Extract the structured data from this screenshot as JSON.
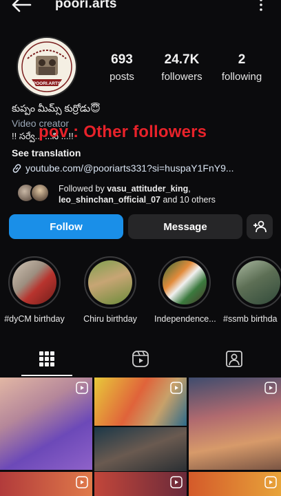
{
  "header": {
    "username": "poori.arts",
    "back_icon": "arrow-left-icon",
    "more_icon": "more-vertical-icon"
  },
  "stats": {
    "posts": {
      "value": "693",
      "label": "posts"
    },
    "followers": {
      "value": "24.7K",
      "label": "followers"
    },
    "following": {
      "value": "2",
      "label": "following"
    }
  },
  "bio": {
    "name": "కుప్పం మీమ్స్ కుర్రోడు😇",
    "category": "Video creator",
    "line": "!! సర్వే... ...ని ...!!",
    "see_translation": "See translation",
    "link": "youtube.com/@pooriarts331?si=huspaY1FnY9..."
  },
  "overlay_caption": "pov : Other followers",
  "followed_by": {
    "prefix": "Followed by ",
    "user1": "vasu_attituder_king",
    "sep": ",",
    "user2": "leo_shinchan_official_07",
    "suffix": " and 10 others"
  },
  "actions": {
    "follow": "Follow",
    "message": "Message",
    "add_user_icon": "person-add-icon"
  },
  "highlights": [
    {
      "label": "#dyCM birthday"
    },
    {
      "label": "Chiru birthday"
    },
    {
      "label": "Independence..."
    },
    {
      "label": "#ssmb birthda"
    }
  ],
  "tabs": [
    {
      "name": "posts",
      "icon": "grid-icon"
    },
    {
      "name": "reels",
      "icon": "reels-icon"
    },
    {
      "name": "tagged",
      "icon": "tagged-person-icon"
    }
  ],
  "colors": {
    "accent": "#1a8fe8",
    "background": "#0b0b0d",
    "overlay_text": "#e8222a",
    "secondary_text": "#9aa7b6"
  }
}
